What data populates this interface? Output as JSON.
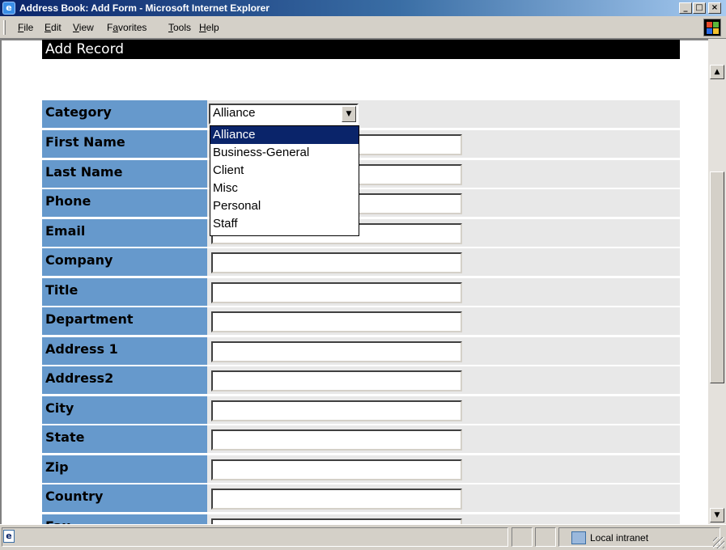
{
  "window": {
    "title": "Address Book: Add Form - Microsoft Internet Explorer",
    "minimize": "_",
    "maximize": "□",
    "close": "×"
  },
  "menu": {
    "file": {
      "u": "F",
      "rest": "ile"
    },
    "edit": {
      "u": "E",
      "rest": "dit"
    },
    "view": {
      "u": "V",
      "rest": "iew"
    },
    "favorites": {
      "pre": "F",
      "u": "a",
      "rest": "vorites"
    },
    "tools": {
      "u": "T",
      "rest": "ools"
    },
    "help": {
      "u": "H",
      "rest": "elp"
    }
  },
  "form": {
    "header": "Add Record",
    "category_label": "Category",
    "category_selected": "Alliance",
    "category_options": [
      "Alliance",
      "Business-General",
      "Client",
      "Misc",
      "Personal",
      "Staff"
    ],
    "fields": [
      {
        "label": "First Name",
        "value": ""
      },
      {
        "label": "Last Name",
        "value": ""
      },
      {
        "label": "Phone",
        "value": ""
      },
      {
        "label": "Email",
        "value": ""
      },
      {
        "label": "Company",
        "value": ""
      },
      {
        "label": "Title",
        "value": ""
      },
      {
        "label": "Department",
        "value": ""
      },
      {
        "label": "Address 1",
        "value": ""
      },
      {
        "label": "Address2",
        "value": ""
      },
      {
        "label": "City",
        "value": ""
      },
      {
        "label": "State",
        "value": ""
      },
      {
        "label": "Zip",
        "value": ""
      },
      {
        "label": "Country",
        "value": ""
      },
      {
        "label": "Fax",
        "value": ""
      }
    ]
  },
  "status": {
    "zone": "Local intranet"
  },
  "colors": {
    "label_bg": "#6699cc",
    "cell_bg": "#e8e8e8",
    "header_bg": "#000000",
    "selection": "#0a246a"
  }
}
